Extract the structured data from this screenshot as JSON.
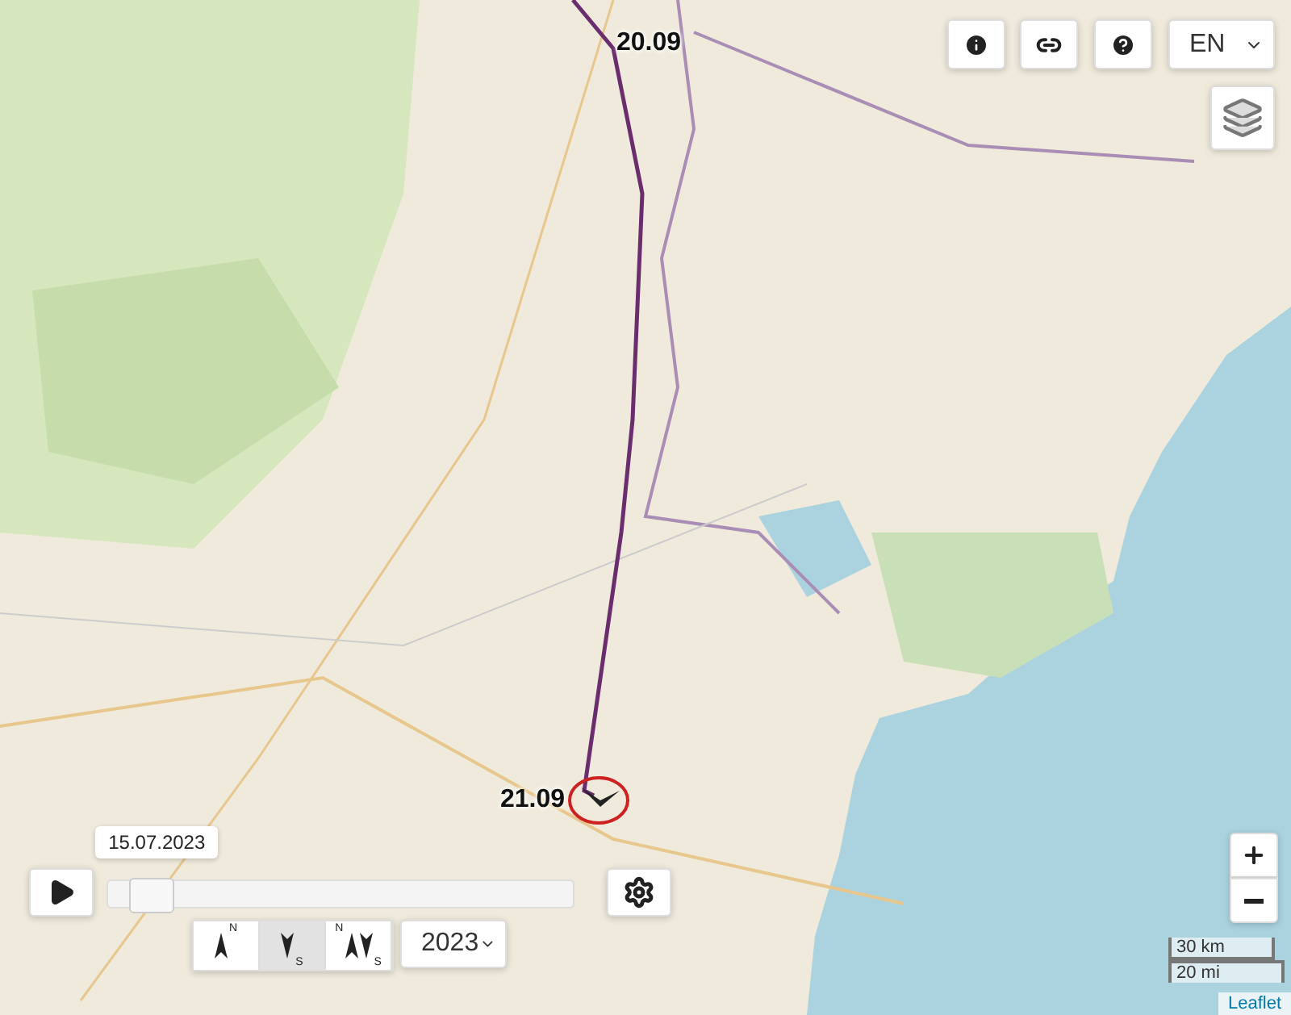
{
  "top_controls": {
    "language": "EN"
  },
  "track": {
    "labels": [
      {
        "text": "20.09",
        "kind": "start"
      },
      {
        "text": "21.09",
        "kind": "end"
      }
    ]
  },
  "timeline": {
    "date": "15.07.2023",
    "level": 0.05
  },
  "direction_buttons": [
    {
      "kind": "north",
      "letters": [
        "N"
      ],
      "selected": false
    },
    {
      "kind": "south",
      "letters": [
        "S"
      ],
      "selected": true
    },
    {
      "kind": "both",
      "letters": [
        "N",
        "S"
      ],
      "selected": false
    }
  ],
  "year": "2023",
  "scale": {
    "metric": "30 km",
    "imperial": "20 mi"
  },
  "attribution": "Leaflet"
}
